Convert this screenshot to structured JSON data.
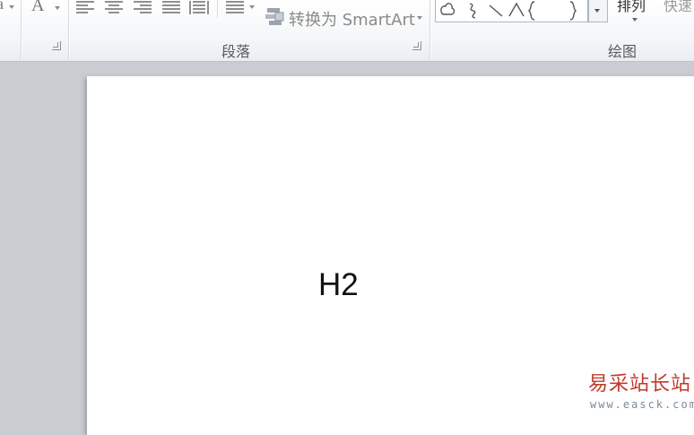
{
  "ribbon": {
    "font_group": {
      "font_color_glyph": "A",
      "left_partial_glyph": "a"
    },
    "paragraph_group": {
      "label": "段落",
      "smartart_label": "转换为 SmartArt",
      "buttons": [
        "align-left",
        "align-center",
        "align-right",
        "justify",
        "distributed",
        "columns"
      ]
    },
    "drawing_group": {
      "label": "绘图",
      "arrange_label": "排列",
      "quick_styles_label": "快速"
    }
  },
  "document": {
    "text": "H2"
  },
  "watermark": {
    "site_name": "易采站长站",
    "url": "www.easck.com"
  }
}
